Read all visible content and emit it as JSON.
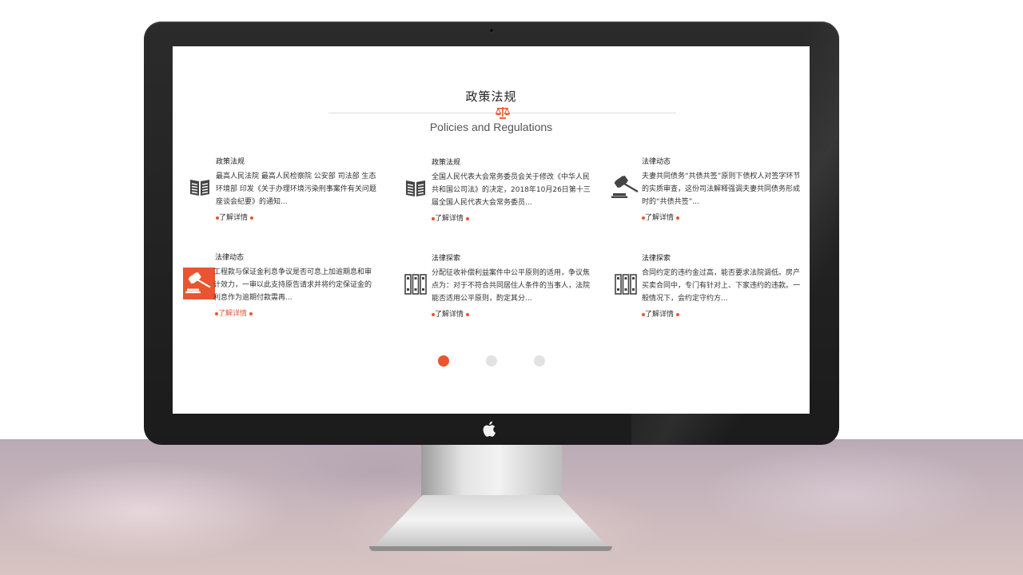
{
  "section": {
    "title": "政策法规",
    "subtitle": "Policies and Regulations"
  },
  "cards": [
    {
      "category": "政策法规",
      "icon": "book-icon",
      "description": "最高人民法院 最高人民检察院 公安部 司法部 生态环境部 印发《关于办理环境污染刑事案件有关问题座谈会纪要》的通知...",
      "link": "了解详情",
      "active": false
    },
    {
      "category": "政策法规",
      "icon": "book-icon",
      "description": "全国人民代表大会常务委员会关于修改《中华人民共和国公司法》的决定，2018年10月26日第十三届全国人民代表大会常务委员...",
      "link": "了解详情",
      "active": false
    },
    {
      "category": "法律动态",
      "icon": "gavel-icon",
      "description": "夫妻共同债务“共债共签”原则下债权人对签字环节的实质审查，这份司法解释强调夫妻共同债务形成时的“共债共签”...",
      "link": "了解详情",
      "active": false
    },
    {
      "category": "法律动态",
      "icon": "gavel-icon",
      "description": "工程款与保证金利息争议是否可息上加逾期息和审计效力，一审以此支持原告请求并将约定保证金的利息作为逾期付款需再...",
      "link": "了解详情",
      "active": true
    },
    {
      "category": "法律探索",
      "icon": "bookshelf-icon",
      "description": "分配征收补偿利益案件中公平原则的适用，争议焦点为：对于不符合共同居住人条件的当事人，法院能否适用公平原则，酌定其分...",
      "link": "了解详情",
      "active": false
    },
    {
      "category": "法律探索",
      "icon": "bookshelf-icon",
      "description": "合同约定的违约金过高，能否要求法院调低。房产买卖合同中，专门有针对上、下家违约的违款。一般情况下，会约定守约方...",
      "link": "了解详情",
      "active": false
    }
  ],
  "pagination": {
    "pages": 3,
    "active_index": 0
  },
  "colors": {
    "accent": "#e8552f",
    "inactive_dot": "#e2e2e2",
    "bezel": "#1f1f1f"
  }
}
